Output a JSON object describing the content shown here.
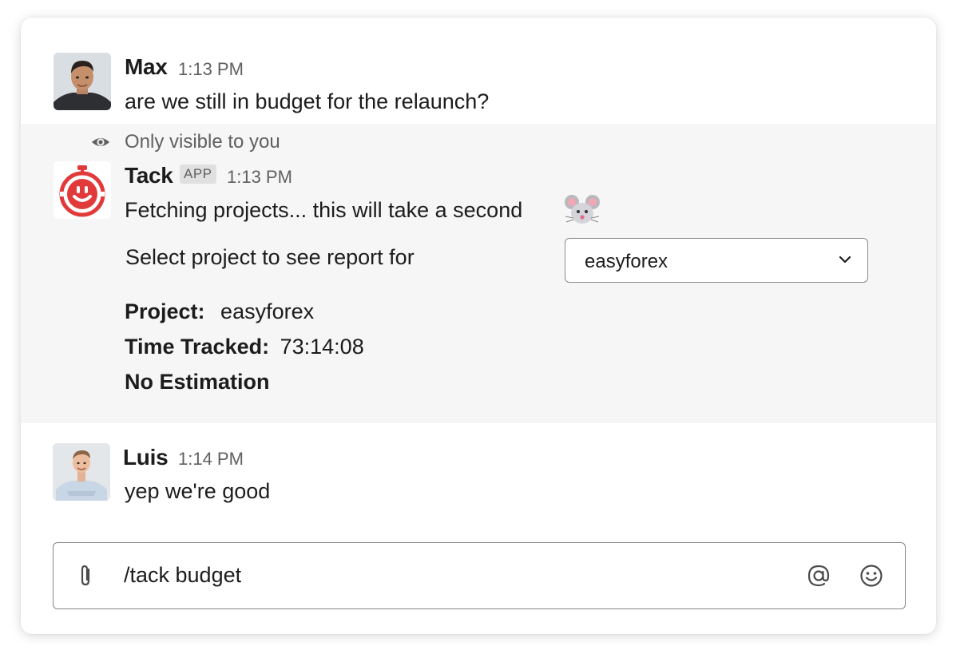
{
  "messages": [
    {
      "author": "Max",
      "time": "1:13 PM",
      "text": "are we still in budget for the relaunch?"
    },
    {
      "visibility_note": "Only visible to you",
      "author": "Tack",
      "badge": "APP",
      "time": "1:13 PM",
      "text": "Fetching projects... this will take a second",
      "emoji": "mouse-face",
      "select_prompt": "Select project to see report for",
      "select_value": "easyforex",
      "project_label": "Project:",
      "project_value": "easyforex",
      "time_tracked_label": "Time Tracked:",
      "time_tracked_value": "73:14:08",
      "estimation": "No Estimation"
    },
    {
      "author": "Luis",
      "time": "1:14 PM",
      "text": "yep we're good"
    }
  ],
  "composer": {
    "value": "/tack budget",
    "icons": [
      "paperclip-icon",
      "at-sign-icon",
      "emoji-icon"
    ]
  },
  "colors": {
    "ephemeral_background": "#f6f6f6",
    "tack_red": "#e23a3a",
    "muted_text": "#616061"
  }
}
